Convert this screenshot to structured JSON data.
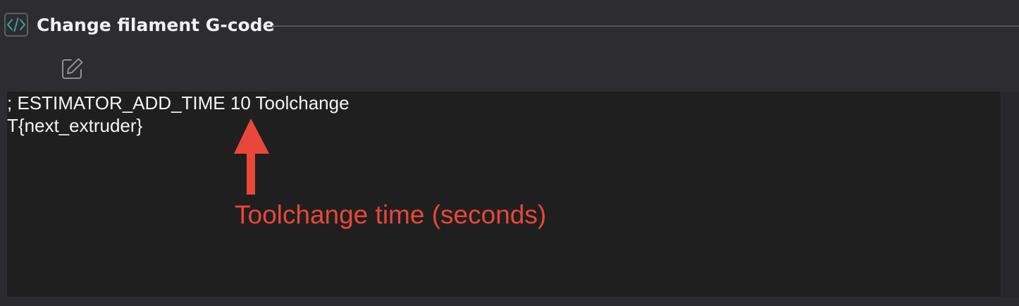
{
  "section": {
    "title": "Change filament G-code",
    "icon": "code-brackets-icon"
  },
  "toolbar": {
    "edit_icon": "edit-pencil-icon"
  },
  "editor": {
    "lines": [
      "; ESTIMATOR_ADD_TIME 10 Toolchange",
      "T{next_extruder}"
    ]
  },
  "annotation": {
    "text": "Toolchange time (seconds)",
    "color": "#e8473a"
  },
  "colors": {
    "background": "#2d2c30",
    "editor_background": "#1f1f1f",
    "icon_accent": "#3aa39a",
    "text": "#f4f4f4"
  }
}
